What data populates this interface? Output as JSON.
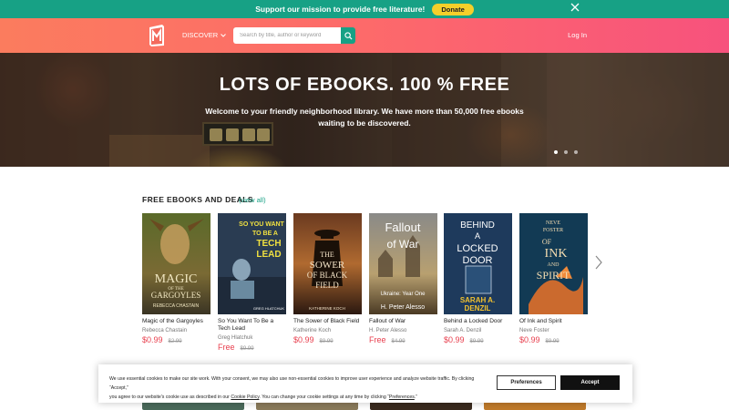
{
  "top_banner": {
    "message": "Support our mission to provide free literature!",
    "donate_label": "Donate",
    "close_icon": "close-icon"
  },
  "header": {
    "logo_icon": "book-logo-icon",
    "discover_label": "DISCOVER",
    "search_placeholder": "Search by title, author or keyword",
    "search_icon": "search-icon",
    "login_label": "Log In"
  },
  "hero": {
    "title": "LOTS OF EBOOKS. 100 % FREE",
    "subtitle": "Welcome to your friendly neighborhood library. We have more than 50,000 free ebooks waiting to be discovered.",
    "slide_count": 3,
    "active_slide": 1
  },
  "section": {
    "title": "FREE EBOOKS AND DEALS",
    "view_all": "(view all)"
  },
  "books": [
    {
      "title": "Magic of the Gargoyles",
      "author": "Rebecca Chastain",
      "price": "$0.99",
      "old_price": "$2.99",
      "cover_lines": [
        "MAGIC",
        "OF THE",
        "GARGOYLES",
        "REBECCA CHASTAIN"
      ]
    },
    {
      "title": "So You Want To Be a Tech Lead",
      "author": "Greg Hlatchuk",
      "price": "Free",
      "old_price": "$9.99",
      "cover_lines": [
        "SO YOU WANT",
        "TO BE A",
        "TECH",
        "LEAD",
        "GREG HLATCHUK"
      ]
    },
    {
      "title": "The Sower of Black Field",
      "author": "Katherine Koch",
      "price": "$0.99",
      "old_price": "$9.99",
      "cover_lines": [
        "THE",
        "SOWER",
        "OF BLACK",
        "FIELD",
        "KATHERINE KOCH"
      ]
    },
    {
      "title": "Fallout of War",
      "author": "H. Peter Alesso",
      "price": "Free",
      "old_price": "$4.99",
      "cover_lines": [
        "Fallout",
        "of War",
        "Ukraine: Year One",
        "H. Peter Alesso"
      ]
    },
    {
      "title": "Behind a Locked Door",
      "author": "Sarah A. Denzil",
      "price": "$0.99",
      "old_price": "$9.99",
      "cover_lines": [
        "BEHIND",
        "A",
        "LOCKED",
        "DOOR",
        "SARAH A.",
        "DENZIL"
      ]
    },
    {
      "title": "Of Ink and Spirit",
      "author": "Neve Foster",
      "price": "$0.99",
      "old_price": "$9.99",
      "cover_lines": [
        "NEVE",
        "FOSTER",
        "OF",
        "INK",
        "AND",
        "SPIRIT"
      ]
    }
  ],
  "carousel": {
    "next_icon": "chevron-right-icon"
  },
  "cookie": {
    "text_part1": "We use essential cookies to make our site work. With your consent, we may also use non-essential cookies to improve user experience and analyze website traffic. By clicking “Accept,”",
    "text_part2": "you agree to our website's cookie use as described in our",
    "link1": "Cookie Policy",
    "text_part3": ". You can change your cookie settings at any time by clicking “",
    "link2": "Preferences",
    "text_part4": ".”",
    "preferences_label": "Preferences",
    "accept_label": "Accept"
  },
  "colors": {
    "accent_green": "#17a185",
    "header_gradient_start": "#fb7c5e",
    "header_gradient_end": "#f7527d",
    "price_red": "#e8404f",
    "donate_yellow": "#f5cf2a"
  }
}
